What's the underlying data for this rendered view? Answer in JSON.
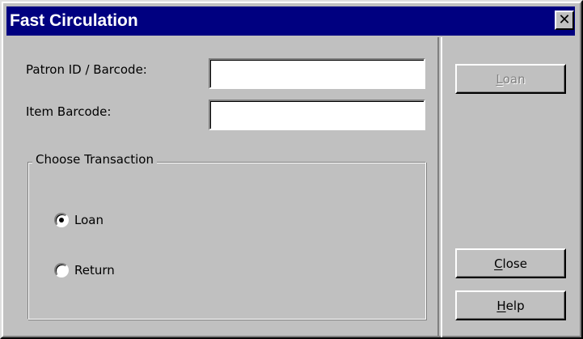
{
  "window": {
    "title": "Fast Circulation",
    "close_glyph": "✕"
  },
  "form": {
    "patron_label": "Patron ID / Barcode:",
    "patron_value": "",
    "item_label": "Item Barcode:",
    "item_value": ""
  },
  "transaction": {
    "group_label": "Choose Transaction",
    "options": [
      {
        "label": "Loan",
        "selected": true
      },
      {
        "label": "Return",
        "selected": false
      }
    ]
  },
  "buttons": {
    "loan": {
      "mnemonic": "L",
      "rest": "oan",
      "enabled": false
    },
    "close": {
      "mnemonic": "C",
      "rest": "lose",
      "enabled": true
    },
    "help": {
      "mnemonic": "H",
      "rest": "elp",
      "enabled": true
    }
  },
  "colors": {
    "titlebar": "#000080",
    "face": "#c0c0c0",
    "disabled_text": "#808080"
  }
}
